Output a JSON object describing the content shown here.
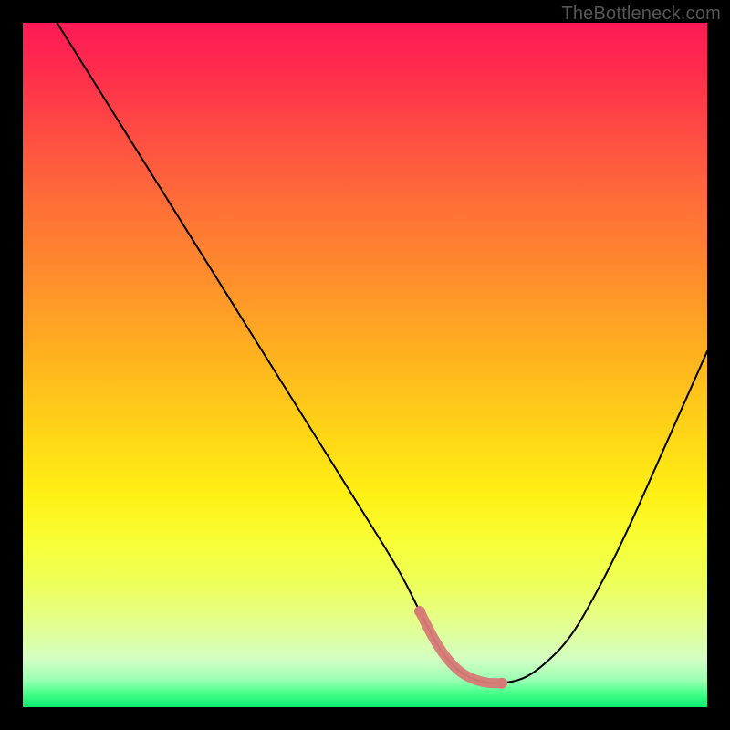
{
  "watermark": "TheBottleneck.com",
  "chart_data": {
    "type": "line",
    "title": "",
    "xlabel": "",
    "ylabel": "",
    "xlim": [
      0,
      100
    ],
    "ylim": [
      0,
      100
    ],
    "series": [
      {
        "name": "bottleneck-curve",
        "x": [
          5,
          10,
          15,
          20,
          25,
          30,
          35,
          40,
          45,
          50,
          55,
          58,
          60,
          62,
          64,
          66,
          68,
          70,
          73,
          76,
          80,
          84,
          88,
          92,
          96,
          100
        ],
        "values": [
          100,
          92,
          84,
          76,
          68,
          60,
          52,
          44,
          36,
          28,
          20,
          14,
          10,
          7,
          5,
          4,
          3.5,
          3.5,
          4,
          6,
          10,
          17,
          25,
          34,
          43,
          52
        ]
      }
    ],
    "annotations": [
      {
        "name": "highlighted-minimum-band",
        "x_range": [
          58,
          72
        ],
        "y_approx": 3.5
      }
    ],
    "background": {
      "type": "vertical-gradient",
      "stops": [
        {
          "pos": 0.0,
          "color": "#ff1a55"
        },
        {
          "pos": 0.25,
          "color": "#ff6b3a"
        },
        {
          "pos": 0.5,
          "color": "#ffc01e"
        },
        {
          "pos": 0.75,
          "color": "#f5ff3c"
        },
        {
          "pos": 0.95,
          "color": "#b8ffb0"
        },
        {
          "pos": 1.0,
          "color": "#10e96f"
        }
      ]
    }
  },
  "colors": {
    "curve": "#000000",
    "highlight": "#d67a76"
  }
}
